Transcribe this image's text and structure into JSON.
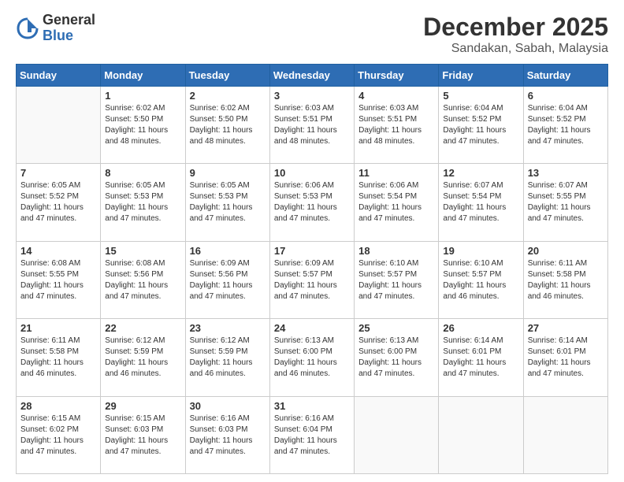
{
  "header": {
    "logo_general": "General",
    "logo_blue": "Blue",
    "main_title": "December 2025",
    "sub_title": "Sandakan, Sabah, Malaysia"
  },
  "calendar": {
    "days_of_week": [
      "Sunday",
      "Monday",
      "Tuesday",
      "Wednesday",
      "Thursday",
      "Friday",
      "Saturday"
    ],
    "weeks": [
      [
        {
          "day": "",
          "info": ""
        },
        {
          "day": "1",
          "info": "Sunrise: 6:02 AM\nSunset: 5:50 PM\nDaylight: 11 hours\nand 48 minutes."
        },
        {
          "day": "2",
          "info": "Sunrise: 6:02 AM\nSunset: 5:50 PM\nDaylight: 11 hours\nand 48 minutes."
        },
        {
          "day": "3",
          "info": "Sunrise: 6:03 AM\nSunset: 5:51 PM\nDaylight: 11 hours\nand 48 minutes."
        },
        {
          "day": "4",
          "info": "Sunrise: 6:03 AM\nSunset: 5:51 PM\nDaylight: 11 hours\nand 48 minutes."
        },
        {
          "day": "5",
          "info": "Sunrise: 6:04 AM\nSunset: 5:52 PM\nDaylight: 11 hours\nand 47 minutes."
        },
        {
          "day": "6",
          "info": "Sunrise: 6:04 AM\nSunset: 5:52 PM\nDaylight: 11 hours\nand 47 minutes."
        }
      ],
      [
        {
          "day": "7",
          "info": "Sunrise: 6:05 AM\nSunset: 5:52 PM\nDaylight: 11 hours\nand 47 minutes."
        },
        {
          "day": "8",
          "info": "Sunrise: 6:05 AM\nSunset: 5:53 PM\nDaylight: 11 hours\nand 47 minutes."
        },
        {
          "day": "9",
          "info": "Sunrise: 6:05 AM\nSunset: 5:53 PM\nDaylight: 11 hours\nand 47 minutes."
        },
        {
          "day": "10",
          "info": "Sunrise: 6:06 AM\nSunset: 5:53 PM\nDaylight: 11 hours\nand 47 minutes."
        },
        {
          "day": "11",
          "info": "Sunrise: 6:06 AM\nSunset: 5:54 PM\nDaylight: 11 hours\nand 47 minutes."
        },
        {
          "day": "12",
          "info": "Sunrise: 6:07 AM\nSunset: 5:54 PM\nDaylight: 11 hours\nand 47 minutes."
        },
        {
          "day": "13",
          "info": "Sunrise: 6:07 AM\nSunset: 5:55 PM\nDaylight: 11 hours\nand 47 minutes."
        }
      ],
      [
        {
          "day": "14",
          "info": "Sunrise: 6:08 AM\nSunset: 5:55 PM\nDaylight: 11 hours\nand 47 minutes."
        },
        {
          "day": "15",
          "info": "Sunrise: 6:08 AM\nSunset: 5:56 PM\nDaylight: 11 hours\nand 47 minutes."
        },
        {
          "day": "16",
          "info": "Sunrise: 6:09 AM\nSunset: 5:56 PM\nDaylight: 11 hours\nand 47 minutes."
        },
        {
          "day": "17",
          "info": "Sunrise: 6:09 AM\nSunset: 5:57 PM\nDaylight: 11 hours\nand 47 minutes."
        },
        {
          "day": "18",
          "info": "Sunrise: 6:10 AM\nSunset: 5:57 PM\nDaylight: 11 hours\nand 47 minutes."
        },
        {
          "day": "19",
          "info": "Sunrise: 6:10 AM\nSunset: 5:57 PM\nDaylight: 11 hours\nand 46 minutes."
        },
        {
          "day": "20",
          "info": "Sunrise: 6:11 AM\nSunset: 5:58 PM\nDaylight: 11 hours\nand 46 minutes."
        }
      ],
      [
        {
          "day": "21",
          "info": "Sunrise: 6:11 AM\nSunset: 5:58 PM\nDaylight: 11 hours\nand 46 minutes."
        },
        {
          "day": "22",
          "info": "Sunrise: 6:12 AM\nSunset: 5:59 PM\nDaylight: 11 hours\nand 46 minutes."
        },
        {
          "day": "23",
          "info": "Sunrise: 6:12 AM\nSunset: 5:59 PM\nDaylight: 11 hours\nand 46 minutes."
        },
        {
          "day": "24",
          "info": "Sunrise: 6:13 AM\nSunset: 6:00 PM\nDaylight: 11 hours\nand 46 minutes."
        },
        {
          "day": "25",
          "info": "Sunrise: 6:13 AM\nSunset: 6:00 PM\nDaylight: 11 hours\nand 47 minutes."
        },
        {
          "day": "26",
          "info": "Sunrise: 6:14 AM\nSunset: 6:01 PM\nDaylight: 11 hours\nand 47 minutes."
        },
        {
          "day": "27",
          "info": "Sunrise: 6:14 AM\nSunset: 6:01 PM\nDaylight: 11 hours\nand 47 minutes."
        }
      ],
      [
        {
          "day": "28",
          "info": "Sunrise: 6:15 AM\nSunset: 6:02 PM\nDaylight: 11 hours\nand 47 minutes."
        },
        {
          "day": "29",
          "info": "Sunrise: 6:15 AM\nSunset: 6:03 PM\nDaylight: 11 hours\nand 47 minutes."
        },
        {
          "day": "30",
          "info": "Sunrise: 6:16 AM\nSunset: 6:03 PM\nDaylight: 11 hours\nand 47 minutes."
        },
        {
          "day": "31",
          "info": "Sunrise: 6:16 AM\nSunset: 6:04 PM\nDaylight: 11 hours\nand 47 minutes."
        },
        {
          "day": "",
          "info": ""
        },
        {
          "day": "",
          "info": ""
        },
        {
          "day": "",
          "info": ""
        }
      ]
    ]
  }
}
